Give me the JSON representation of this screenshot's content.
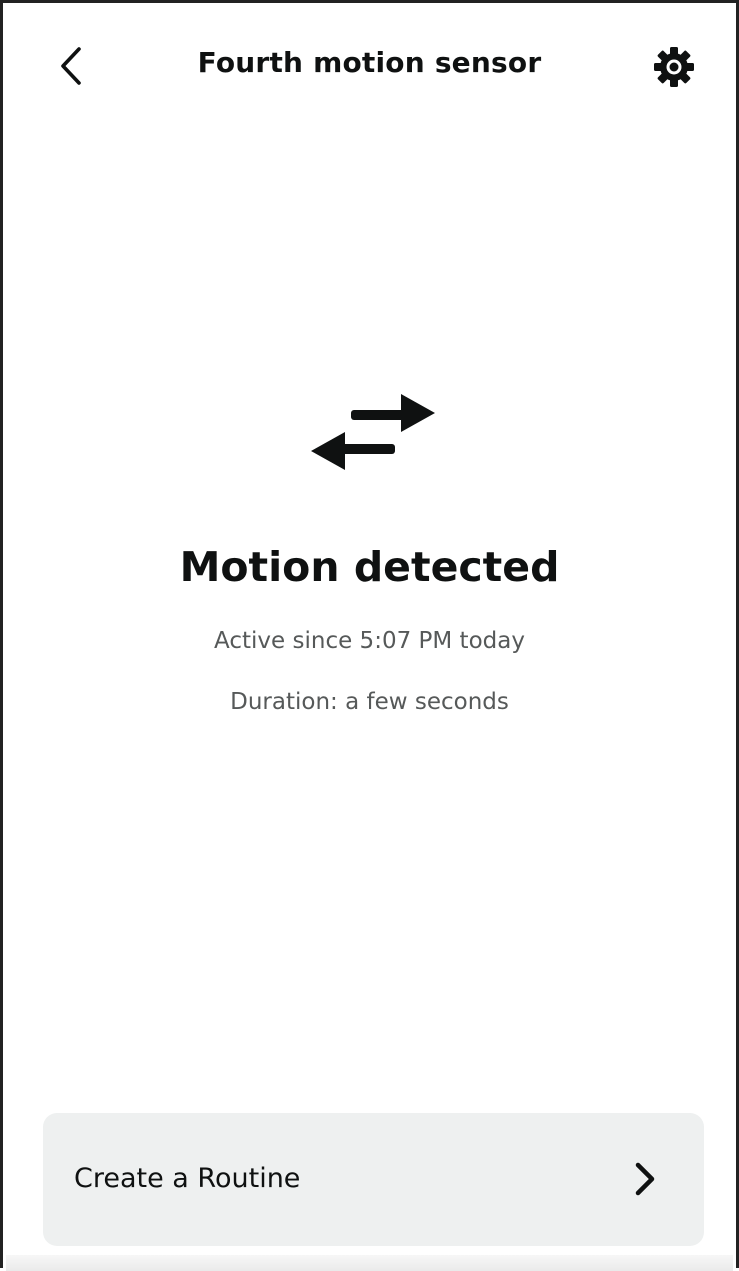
{
  "header": {
    "title": "Fourth motion sensor",
    "back_icon": "chevron-left-icon",
    "settings_icon": "gear-icon"
  },
  "status": {
    "icon": "swap-arrows-icon",
    "title": "Motion detected",
    "active_since": "Active since 5:07 PM today",
    "duration": "Duration: a few seconds"
  },
  "routine": {
    "label": "Create a Routine",
    "chevron_icon": "chevron-right-icon"
  },
  "colors": {
    "text_primary": "#0f1111",
    "text_secondary": "#565959",
    "card_background": "#eef0f0"
  }
}
